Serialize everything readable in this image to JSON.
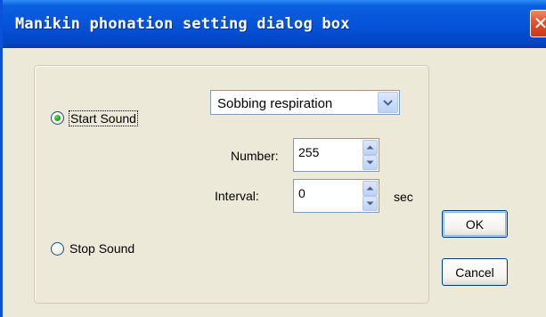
{
  "window": {
    "title": "Manikin phonation setting dialog box",
    "close_glyph": "✕",
    "accent_color": "#0653d8",
    "close_color": "#e2552e"
  },
  "sound": {
    "start_label": "Start Sound",
    "stop_label": "Stop Sound",
    "selected": "start"
  },
  "combo": {
    "value": "Sobbing respiration",
    "icon": "chevron-down-icon"
  },
  "number": {
    "label": "Number:",
    "value": "255"
  },
  "interval": {
    "label": "Interval:",
    "value": "0",
    "unit": "sec"
  },
  "buttons": {
    "ok": "OK",
    "cancel": "Cancel"
  }
}
